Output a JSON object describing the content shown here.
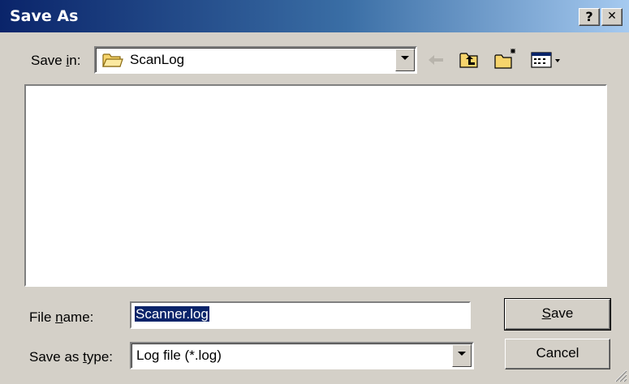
{
  "window": {
    "title": "Save As",
    "help_button": "?",
    "close_button": "✕"
  },
  "toolbar": {
    "save_in_label_pre": "Save ",
    "save_in_label_accel": "i",
    "save_in_label_post": "n:",
    "current_folder": "ScanLog",
    "icons": [
      "back-arrow-icon",
      "up-one-level-icon",
      "new-folder-icon",
      "view-menu-icon"
    ]
  },
  "file_list": {
    "items": []
  },
  "form": {
    "file_name_label_pre": "File ",
    "file_name_label_accel": "n",
    "file_name_label_post": "ame:",
    "file_name_value": "Scanner.log",
    "save_type_label_pre": "Save as ",
    "save_type_label_accel": "t",
    "save_type_label_post": "ype:",
    "save_type_value": "Log file (*.log)"
  },
  "buttons": {
    "save_accel": "S",
    "save_rest": "ave",
    "cancel": "Cancel"
  },
  "colors": {
    "title_start": "#0a246a",
    "title_end": "#a6caf0",
    "face": "#d4d0c8",
    "selection": "#0a246a",
    "folder": "#f6d46c"
  }
}
